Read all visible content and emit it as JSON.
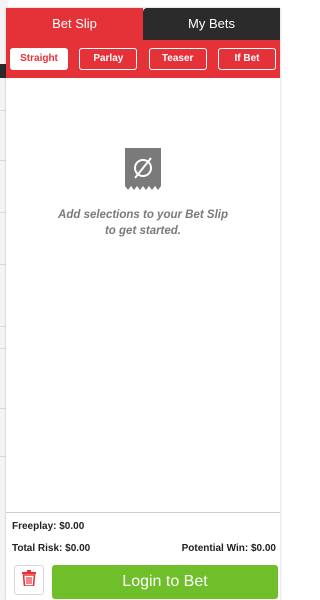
{
  "tabs": [
    {
      "label": "Bet Slip",
      "active": true
    },
    {
      "label": "My Bets",
      "active": false
    }
  ],
  "bet_types": [
    {
      "label": "Straight",
      "active": true
    },
    {
      "label": "Parlay",
      "active": false
    },
    {
      "label": "Teaser",
      "active": false
    },
    {
      "label": "If Bet",
      "active": false
    }
  ],
  "empty_state": {
    "icon": "no-ticket-icon",
    "line1": "Add selections to your Bet Slip",
    "line2": "to get started."
  },
  "footer": {
    "freeplay_label": "Freeplay:",
    "freeplay_value": "$0.00",
    "total_risk_label": "Total Risk:",
    "total_risk_value": "$0.00",
    "potential_win_label": "Potential Win:",
    "potential_win_value": "$0.00",
    "login_label": "Login to Bet",
    "trash_icon": "trash-icon"
  },
  "colors": {
    "accent": "#e53238",
    "dark_tab": "#2b2b2b",
    "login_green": "#6ebf2a",
    "icon_gray": "#7a7a7a"
  }
}
